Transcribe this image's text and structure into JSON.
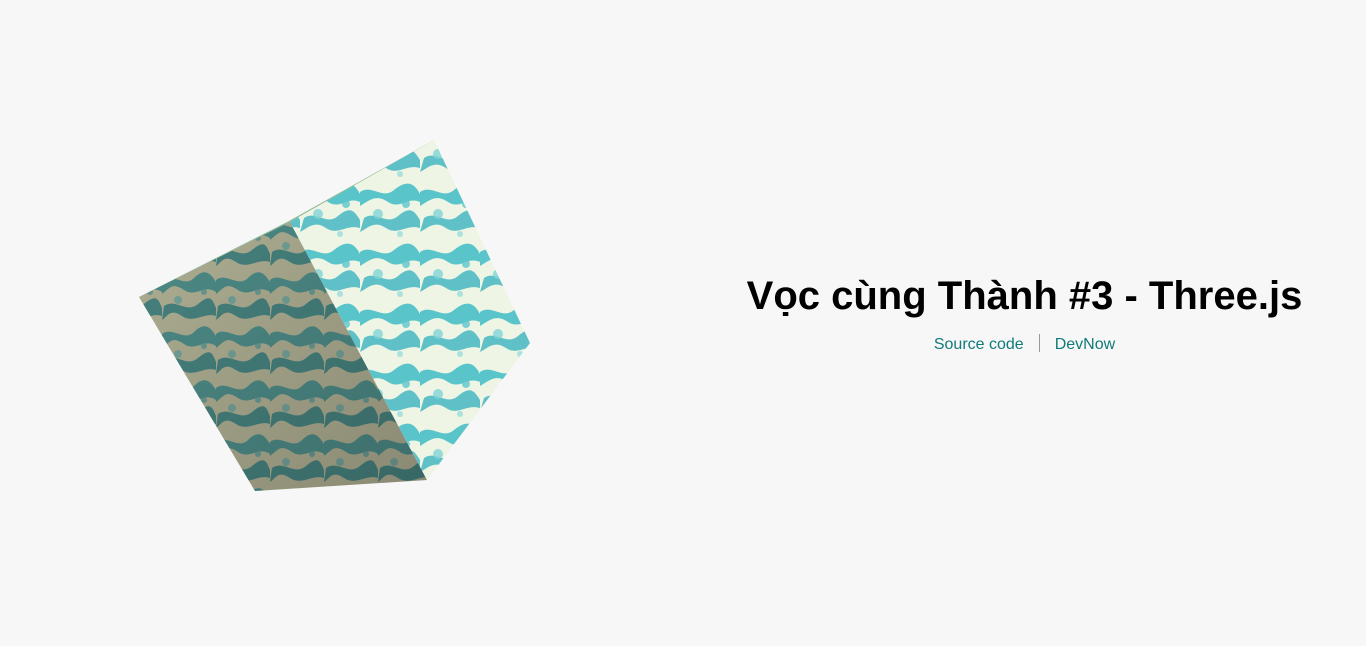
{
  "page": {
    "title": "Vọc cùng Thành #3 - Three.js",
    "links": {
      "source_code": "Source code",
      "devnow": "DevNow"
    }
  },
  "scene": {
    "object": "rotating textured cube",
    "texture": "water-caustics",
    "colors": {
      "background": "#f7f7f7",
      "teal": "#3fbcc6",
      "cream": "#f3f6e6",
      "dark_teal": "#4a8f8f",
      "top_face": "#8fb896",
      "link": "#117a7a"
    }
  }
}
